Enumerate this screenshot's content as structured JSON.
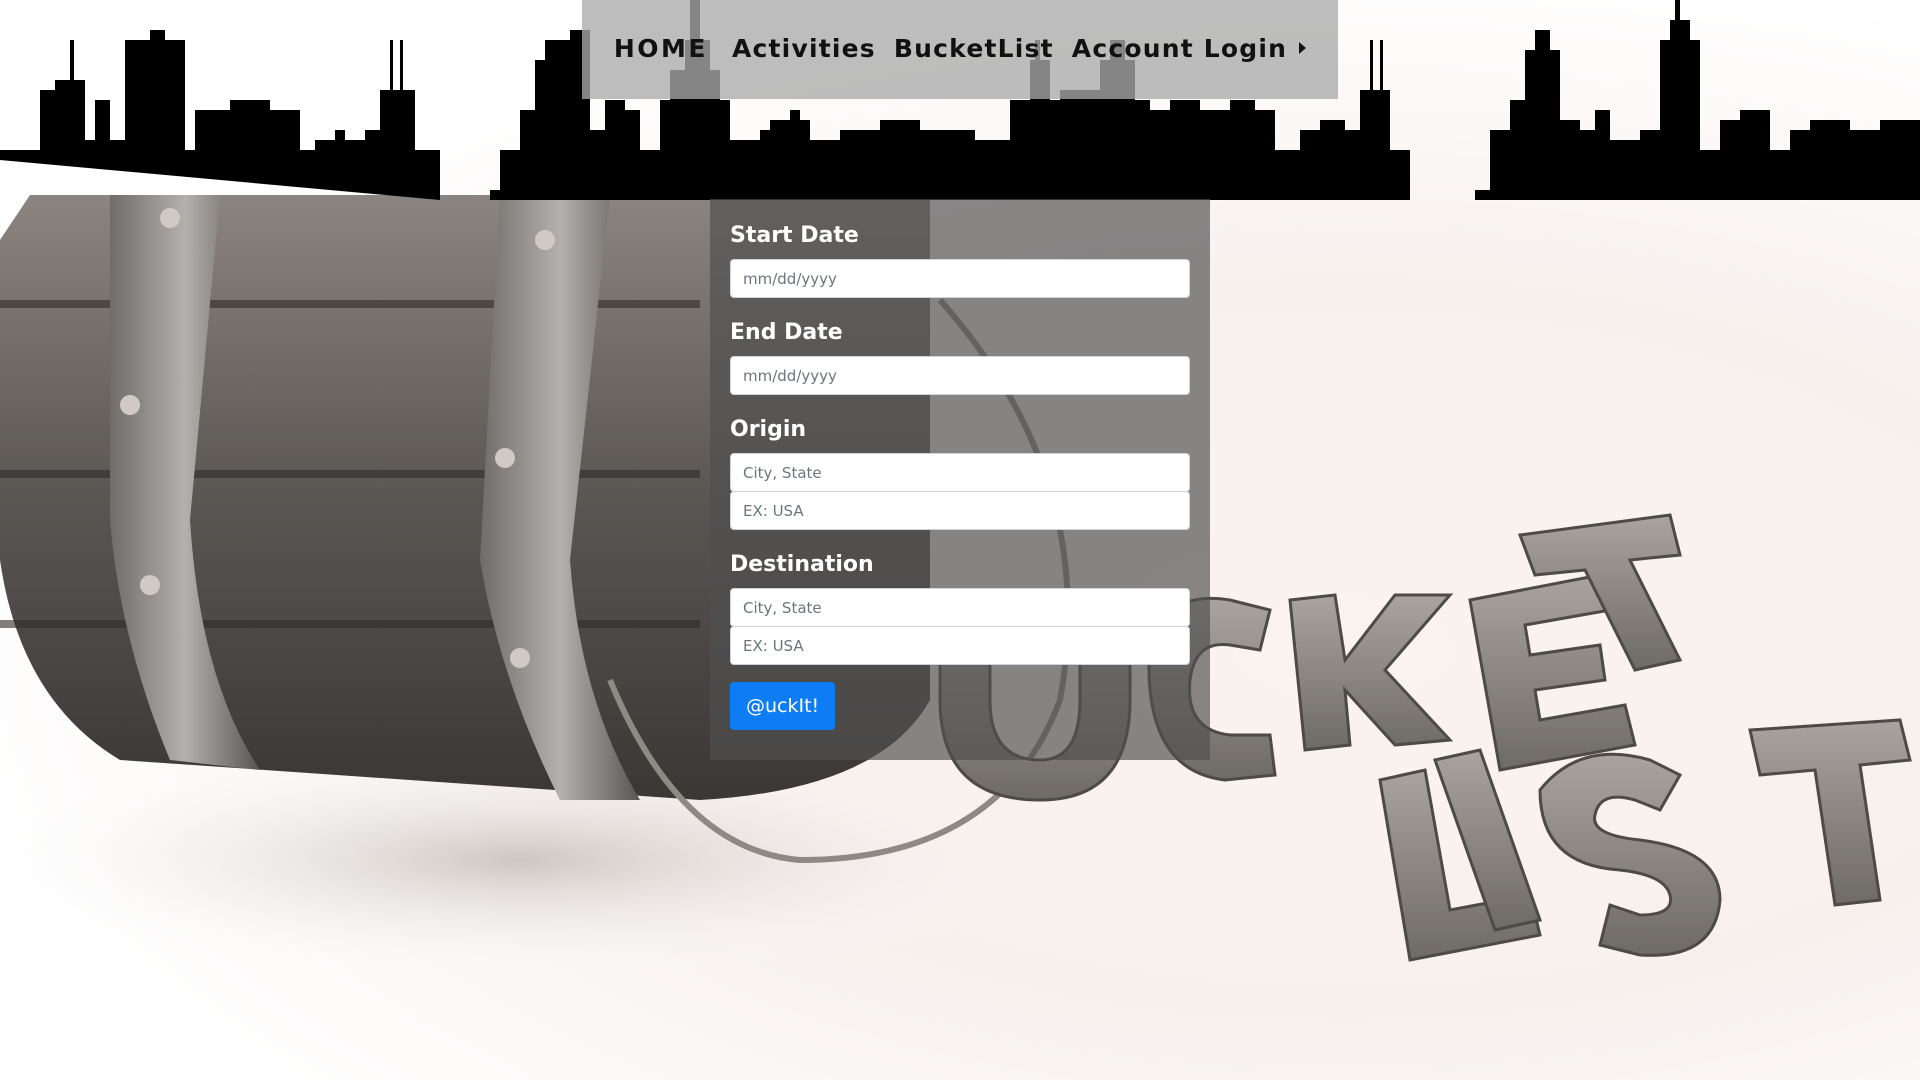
{
  "nav": {
    "home_label": "HOME",
    "activities_label": "Activities",
    "bucketlist_label": "BucketList",
    "account_label": "Account Login"
  },
  "form": {
    "start_date": {
      "label": "Start Date",
      "placeholder": "mm/dd/yyyy"
    },
    "end_date": {
      "label": "End Date",
      "placeholder": "mm/dd/yyyy"
    },
    "origin": {
      "label": "Origin",
      "city_placeholder": "City, State",
      "country_placeholder": "EX: USA"
    },
    "destination": {
      "label": "Destination",
      "city_placeholder": "City, State",
      "country_placeholder": "EX: USA"
    },
    "submit_label": "@uckIt!"
  },
  "colors": {
    "button": "#0d7cf5",
    "panel": "#505050",
    "navbar": "#aaaaaa",
    "skyline": "#000000"
  },
  "icons": {
    "account_caret": "caret-right-icon"
  }
}
